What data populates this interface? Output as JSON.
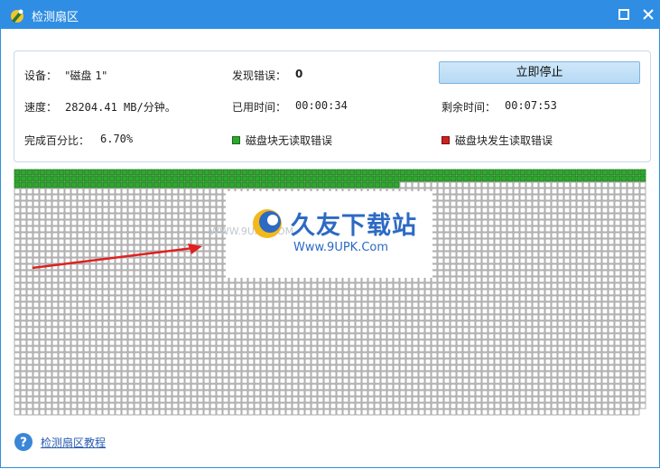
{
  "window": {
    "title": "检测扇区"
  },
  "info": {
    "device_label": "设备：",
    "device_value": "\"磁盘 1\"",
    "errors_label": "发现错误：",
    "errors_value": "0",
    "speed_label": "速度：",
    "speed_value": "28204.41 MB/分钟。",
    "elapsed_label": "已用时间：",
    "elapsed_value": "00:00:34",
    "remaining_label": "剩余时间：",
    "remaining_value": "00:07:53",
    "percent_label": "完成百分比：",
    "percent_value": "6.70%"
  },
  "buttons": {
    "stop_label": "立即停止"
  },
  "legend": {
    "ok_label": "磁盘块无读取错误",
    "ok_color": "#2ea82e",
    "error_label": "磁盘块发生读取错误",
    "error_color": "#d02020"
  },
  "blocks": {
    "completed_fraction": 0.067,
    "ok_color": "#2ea82e",
    "pending_color": "#ffffff",
    "pending_border": "#9a9a9a"
  },
  "watermark": {
    "brand_cn": "久友下载站",
    "brand_en": "Www.9UPK.Com",
    "faint_text": "WWW.9UPK.COM"
  },
  "help": {
    "link_text": "检测扇区教程"
  },
  "colors": {
    "titlebar": "#2f8ee3",
    "accent_link": "#2a5db0"
  }
}
